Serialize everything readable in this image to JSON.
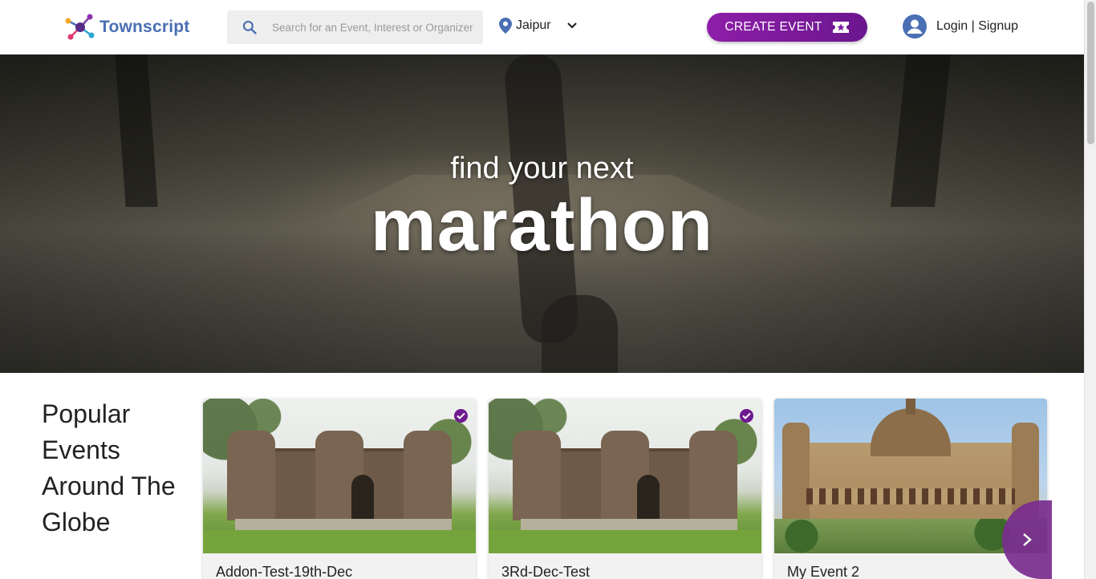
{
  "brand": {
    "name": "Townscript",
    "accent": "#7b1fa2",
    "logo_text_color": "#4a6fb3"
  },
  "header": {
    "search_placeholder": "Search for an Event, Interest or Organizer",
    "city": "Jaipur",
    "create_event_label": "CREATE EVENT",
    "login_label": "Login | Signup"
  },
  "hero": {
    "subtitle": "find your next",
    "title": "marathon"
  },
  "popular": {
    "heading": "Popular Events Around The Globe",
    "cards": [
      {
        "title": "Addon-Test-19th-Dec",
        "verified": true,
        "image": "fort"
      },
      {
        "title": "3Rd-Dec-Test",
        "verified": true,
        "image": "fort"
      },
      {
        "title": "My Event 2",
        "verified": false,
        "image": "railway-station"
      }
    ],
    "next_icon": "chevron-right-icon"
  },
  "icons": {
    "search": "search-icon",
    "location": "location-pin-icon",
    "dropdown": "chevron-down-icon",
    "ticket": "ticket-star-icon",
    "user": "user-avatar-icon"
  }
}
